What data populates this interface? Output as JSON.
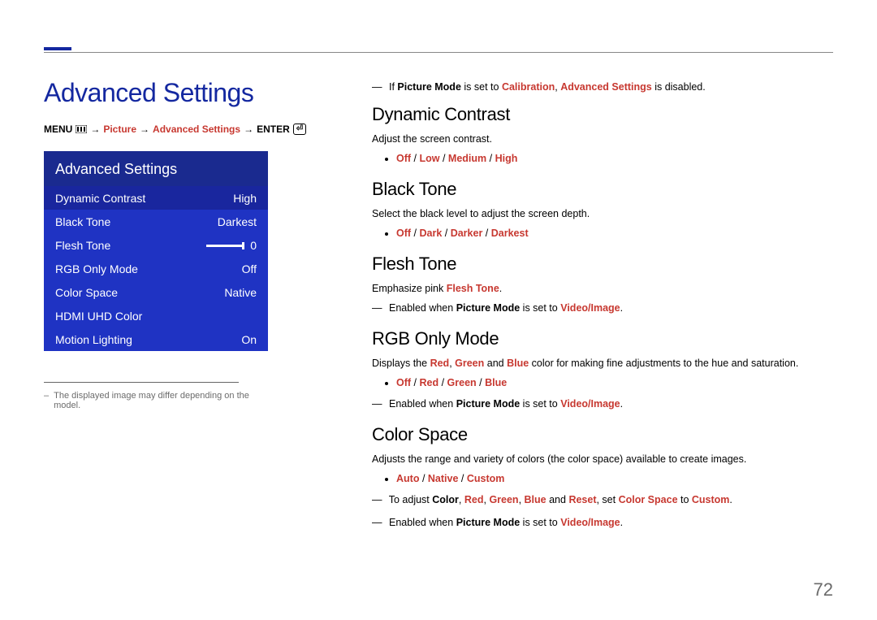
{
  "page_number": "72",
  "title": "Advanced Settings",
  "breadcrumb": {
    "menu": "MENU",
    "picture": "Picture",
    "adv": "Advanced Settings",
    "enter": "ENTER"
  },
  "menu": {
    "header": "Advanced Settings",
    "rows": [
      {
        "label": "Dynamic Contrast",
        "value": "High",
        "selected": true
      },
      {
        "label": "Black Tone",
        "value": "Darkest"
      },
      {
        "label": "Flesh Tone",
        "value": "0",
        "slider": true
      },
      {
        "label": "RGB Only Mode",
        "value": "Off"
      },
      {
        "label": "Color Space",
        "value": "Native"
      },
      {
        "label": "HDMI UHD Color",
        "value": ""
      },
      {
        "label": "Motion Lighting",
        "value": "On"
      }
    ]
  },
  "foot_note_dash": "–",
  "foot_note": "The displayed image may differ depending on the model.",
  "top_note": {
    "pre": "If ",
    "pm": "Picture Mode",
    "mid": " is set to ",
    "cal": "Calibration",
    "mid2": ", ",
    "as": "Advanced Settings",
    "post": " is disabled."
  },
  "sections": {
    "dc": {
      "h": "Dynamic Contrast",
      "desc": "Adjust the screen contrast.",
      "opts": {
        "o1": "Off",
        "s": " / ",
        "o2": "Low",
        "o3": "Medium",
        "o4": "High"
      }
    },
    "bt": {
      "h": "Black Tone",
      "desc": "Select the black level to adjust the screen depth.",
      "opts": {
        "o1": "Off",
        "s": " / ",
        "o2": "Dark",
        "o3": "Darker",
        "o4": "Darkest"
      }
    },
    "ft": {
      "h": "Flesh Tone",
      "desc_pre": "Emphasize pink ",
      "desc_hl": "Flesh Tone",
      "desc_post": ".",
      "note": {
        "pre": "Enabled when ",
        "pm": "Picture Mode",
        "mid": " is set to ",
        "vi": "Video/Image",
        "post": "."
      }
    },
    "rgb": {
      "h": "RGB Only Mode",
      "desc_pre": "Displays the ",
      "r": "Red",
      "c1": ", ",
      "g": "Green",
      "c2": " and ",
      "b": "Blue",
      "desc_post": " color for making fine adjustments to the hue and saturation.",
      "opts": {
        "o1": "Off",
        "s": " / ",
        "o2": "Red",
        "o3": "Green",
        "o4": "Blue"
      },
      "note": {
        "pre": "Enabled when ",
        "pm": "Picture Mode",
        "mid": " is set to ",
        "vi": "Video/Image",
        "post": "."
      }
    },
    "cs": {
      "h": "Color Space",
      "desc": "Adjusts the range and variety of colors (the color space) available to create images.",
      "opts": {
        "o1": "Auto",
        "s": " / ",
        "o2": "Native",
        "o3": "Custom"
      },
      "note1": {
        "pre": "To adjust ",
        "color": "Color",
        "c": ", ",
        "r": "Red",
        "g": "Green",
        "b": "Blue",
        "and": " and ",
        "reset": "Reset",
        "mid": ", set ",
        "csp": "Color Space",
        "to": " to ",
        "cust": "Custom",
        "post": "."
      },
      "note2": {
        "pre": "Enabled when ",
        "pm": "Picture Mode",
        "mid": " is set to ",
        "vi": "Video/Image",
        "post": "."
      }
    }
  }
}
